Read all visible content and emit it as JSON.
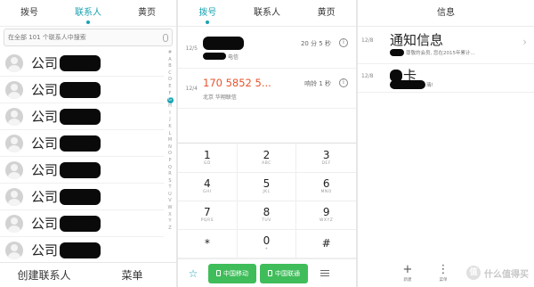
{
  "contacts_screen": {
    "tabs": [
      "拨号",
      "联系人",
      "黄页"
    ],
    "active_tab": 1,
    "search_placeholder": "在全部 101 个联系人中搜索",
    "contacts": [
      "公司",
      "公司",
      "公司",
      "公司",
      "公司",
      "公司",
      "公司",
      "公司"
    ],
    "index_letters": [
      "#",
      "A",
      "B",
      "C",
      "D",
      "E",
      "F",
      "G",
      "H",
      "I",
      "J",
      "K",
      "L",
      "M",
      "N",
      "O",
      "P",
      "Q",
      "R",
      "S",
      "T",
      "U",
      "V",
      "W",
      "X",
      "Y",
      "Z"
    ],
    "highlighted_letter": "G",
    "bottom_buttons": {
      "create": "创建联系人",
      "menu": "菜单"
    }
  },
  "dialer_screen": {
    "tabs": [
      "拨号",
      "联系人",
      "黄页"
    ],
    "active_tab": 0,
    "call_log": [
      {
        "date": "12/5",
        "number": "",
        "missed": false,
        "location": "电信",
        "duration": "20 分 5 秒"
      },
      {
        "date": "12/4",
        "number": "170 5852 5...",
        "missed": true,
        "location": "北京 华翔联信",
        "duration": "响铃 1 秒"
      }
    ],
    "keys": [
      {
        "digit": "1",
        "letters": "GD"
      },
      {
        "digit": "2",
        "letters": "ABC"
      },
      {
        "digit": "3",
        "letters": "DEF"
      },
      {
        "digit": "4",
        "letters": "GHI"
      },
      {
        "digit": "5",
        "letters": "JKL"
      },
      {
        "digit": "6",
        "letters": "MNO"
      },
      {
        "digit": "7",
        "letters": "PQRS"
      },
      {
        "digit": "8",
        "letters": "TUV"
      },
      {
        "digit": "9",
        "letters": "WXYZ"
      },
      {
        "digit": "*",
        "letters": ""
      },
      {
        "digit": "0",
        "letters": "+"
      },
      {
        "digit": "#",
        "letters": ""
      }
    ],
    "call_buttons": [
      "中国移动",
      "中国联通"
    ],
    "accent": "#1aa3b2",
    "call_button_color": "#3fbd5a",
    "missed_color": "#e8532b"
  },
  "messages_screen": {
    "title": "信息",
    "messages": [
      {
        "date": "12/8",
        "title": "通知信息",
        "preview": "尊敬的会员, 您在2015年累计..."
      },
      {
        "date": "12/8",
        "title": "卡",
        "preview": "璃!"
      }
    ],
    "bottom_nav": [
      {
        "icon": "+",
        "label": "新建"
      },
      {
        "icon": "⋮",
        "label": "菜单"
      }
    ],
    "watermark": "值 什么值得买"
  }
}
